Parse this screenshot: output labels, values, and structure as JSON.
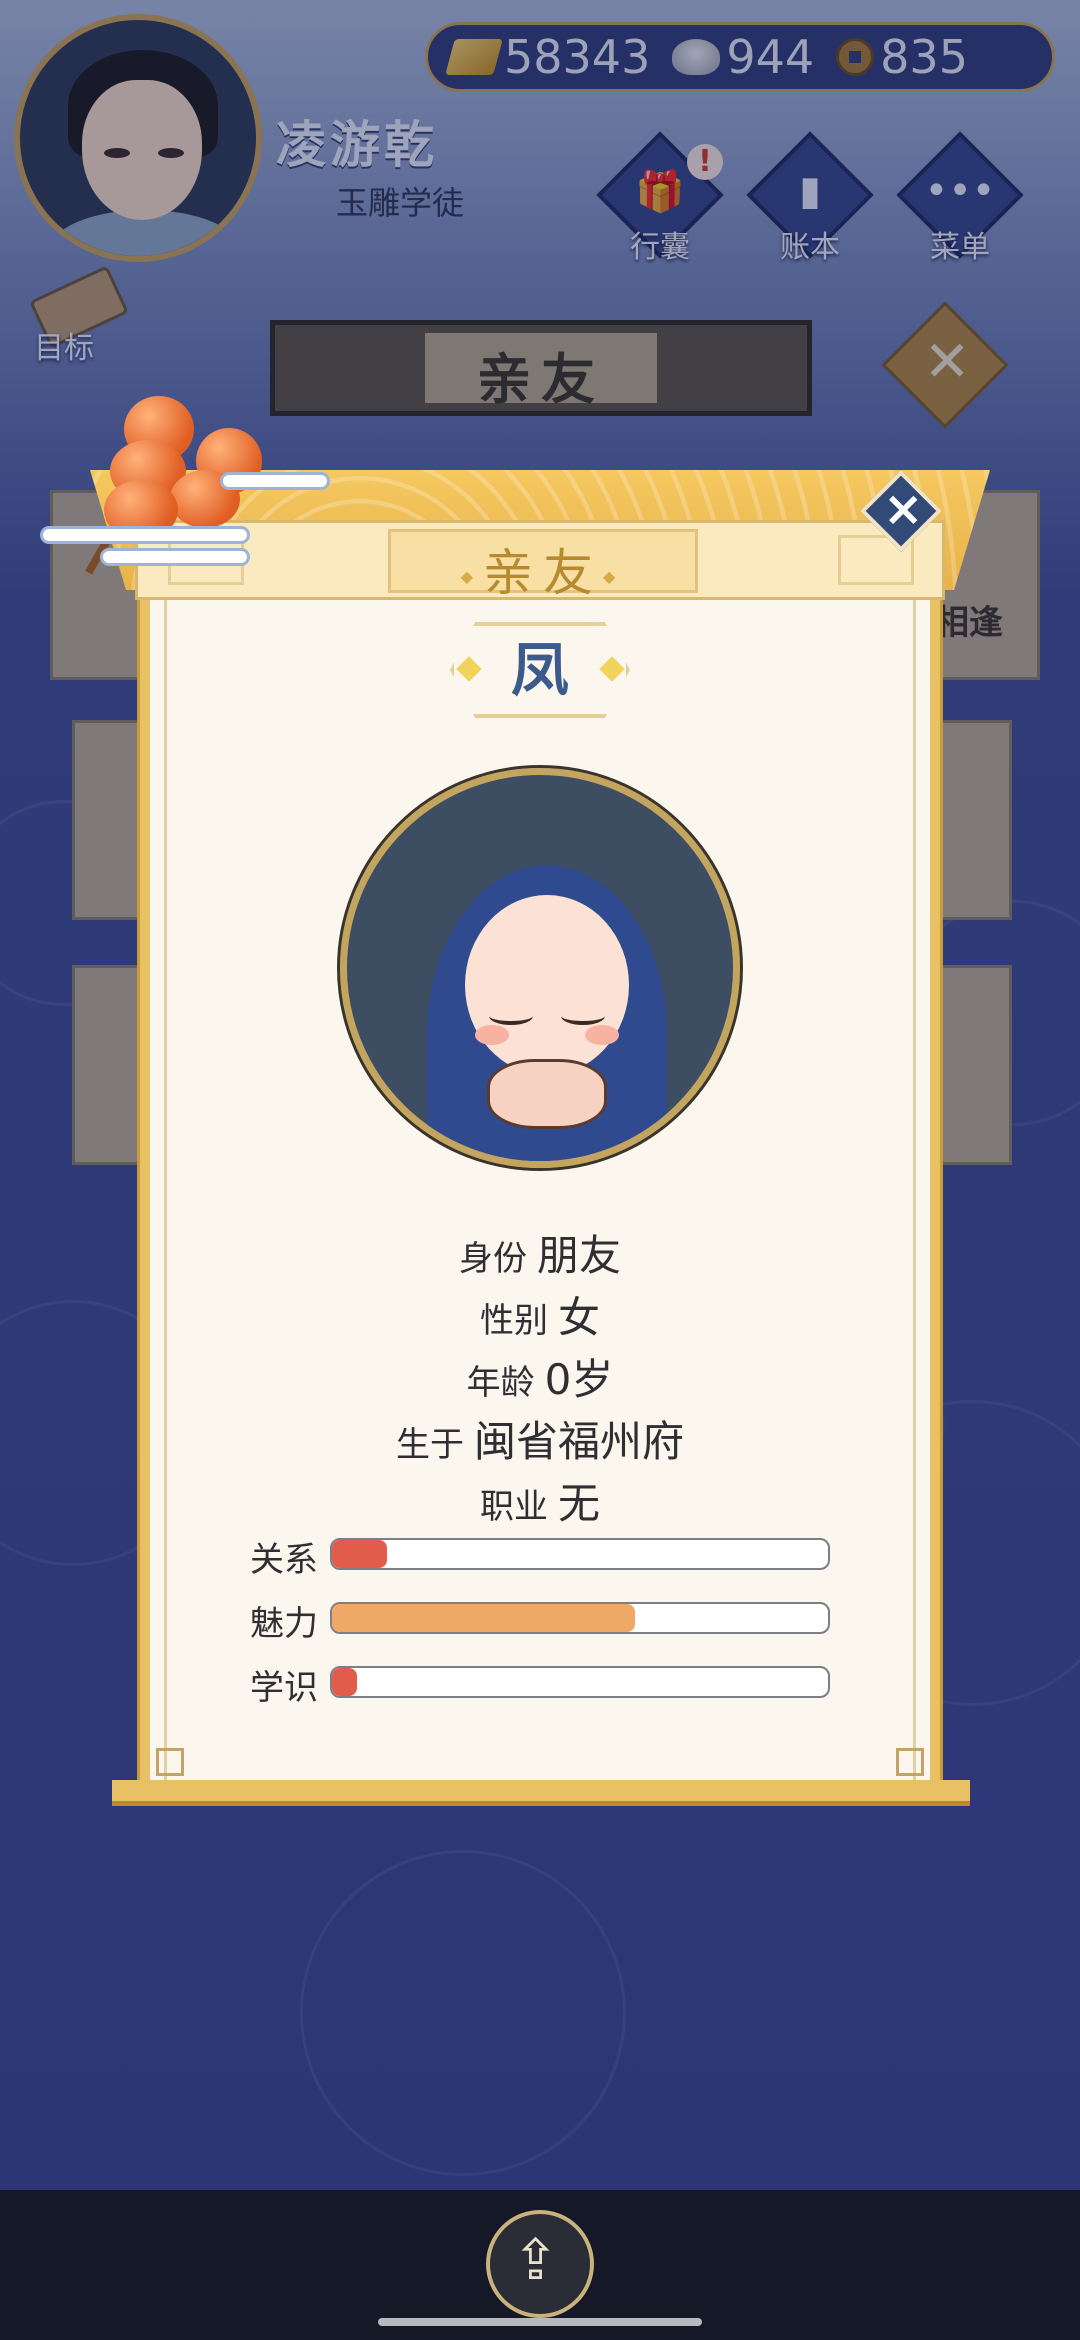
{
  "player": {
    "name": "凌游乾",
    "title": "玉雕学徒"
  },
  "currency": {
    "gold": "58343",
    "silver": "944",
    "coins": "835"
  },
  "hud": {
    "bag_label": "行囊",
    "ledger_label": "账本",
    "menu_label": "菜单",
    "goal_label": "目标",
    "bag_alert": "!"
  },
  "screen": {
    "header_title": "亲友",
    "bg_card_partial_text": "相逢"
  },
  "modal": {
    "tab_title": "亲友",
    "character_name": "凤",
    "info": [
      {
        "key": "身份",
        "value": "朋友"
      },
      {
        "key": "性别",
        "value": "女"
      },
      {
        "key": "年龄",
        "value": "0岁"
      },
      {
        "key": "生于",
        "value": "闽省福州府"
      },
      {
        "key": "职业",
        "value": "无"
      }
    ],
    "stats": [
      {
        "label": "关系",
        "fraction": 0.11,
        "color": "#e25c4b"
      },
      {
        "label": "魅力",
        "fraction": 0.61,
        "color": "#f0a866"
      },
      {
        "label": "学识",
        "fraction": 0.05,
        "color": "#e25c4b"
      }
    ]
  },
  "colors": {
    "accent_gold": "#e9c165",
    "panel_bg": "#fbf7ee",
    "name_blue": "#3d5a8c"
  }
}
